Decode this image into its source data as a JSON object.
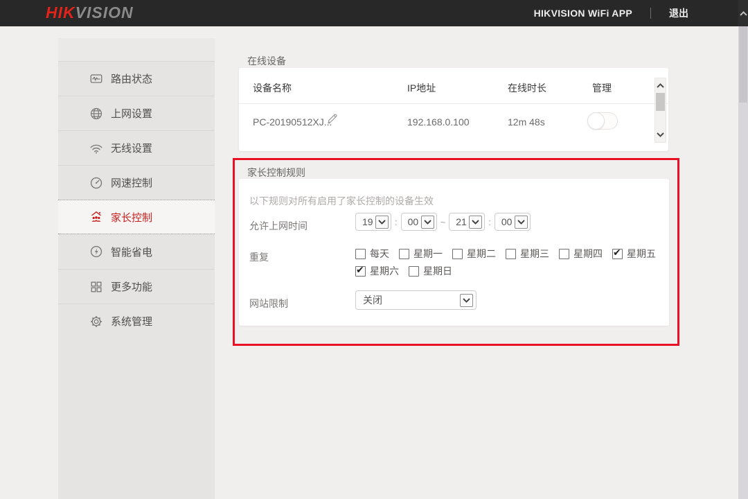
{
  "header": {
    "logo_hik": "HIK",
    "logo_vision": "VISION",
    "app_label": "HIKVISION WiFi APP",
    "logout_label": "退出"
  },
  "sidebar": {
    "items": [
      {
        "label": "路由状态",
        "icon": "router-status-icon",
        "active": false
      },
      {
        "label": "上网设置",
        "icon": "internet-settings-icon",
        "active": false
      },
      {
        "label": "无线设置",
        "icon": "wireless-settings-icon",
        "active": false
      },
      {
        "label": "网速控制",
        "icon": "speed-control-icon",
        "active": false
      },
      {
        "label": "家长控制",
        "icon": "parental-control-icon",
        "active": true
      },
      {
        "label": "智能省电",
        "icon": "power-saving-icon",
        "active": false
      },
      {
        "label": "更多功能",
        "icon": "more-features-icon",
        "active": false
      },
      {
        "label": "系统管理",
        "icon": "system-management-icon",
        "active": false
      }
    ]
  },
  "online_devices": {
    "section_title": "在线设备",
    "columns": {
      "name": "设备名称",
      "ip": "IP地址",
      "duration": "在线时长",
      "manage": "管理"
    },
    "device": {
      "name": "PC-20190512XJ...",
      "ip": "192.168.0.100",
      "duration": "12m 48s",
      "toggle_on": false
    }
  },
  "parental_control": {
    "section_title": "家长控制规则",
    "hint": "以下规则对所有启用了家长控制的设备生效",
    "time_row": {
      "label": "允许上网时间",
      "start_hour": "19",
      "start_minute": "00",
      "end_hour": "21",
      "end_minute": "00",
      "colon": ":",
      "range_separator": "~"
    },
    "repeat_row": {
      "label": "重复",
      "days": [
        {
          "label": "每天",
          "checked": false
        },
        {
          "label": "星期一",
          "checked": false
        },
        {
          "label": "星期二",
          "checked": false
        },
        {
          "label": "星期三",
          "checked": false
        },
        {
          "label": "星期四",
          "checked": false
        },
        {
          "label": "星期五",
          "checked": true
        },
        {
          "label": "星期六",
          "checked": true
        },
        {
          "label": "星期日",
          "checked": false
        }
      ]
    },
    "website_row": {
      "label": "网站限制",
      "value": "关闭"
    }
  },
  "colors": {
    "brand_red": "#e2231a",
    "active_menu_red": "#c5201f",
    "highlight_border": "#e81123",
    "header_bg": "#282828"
  }
}
